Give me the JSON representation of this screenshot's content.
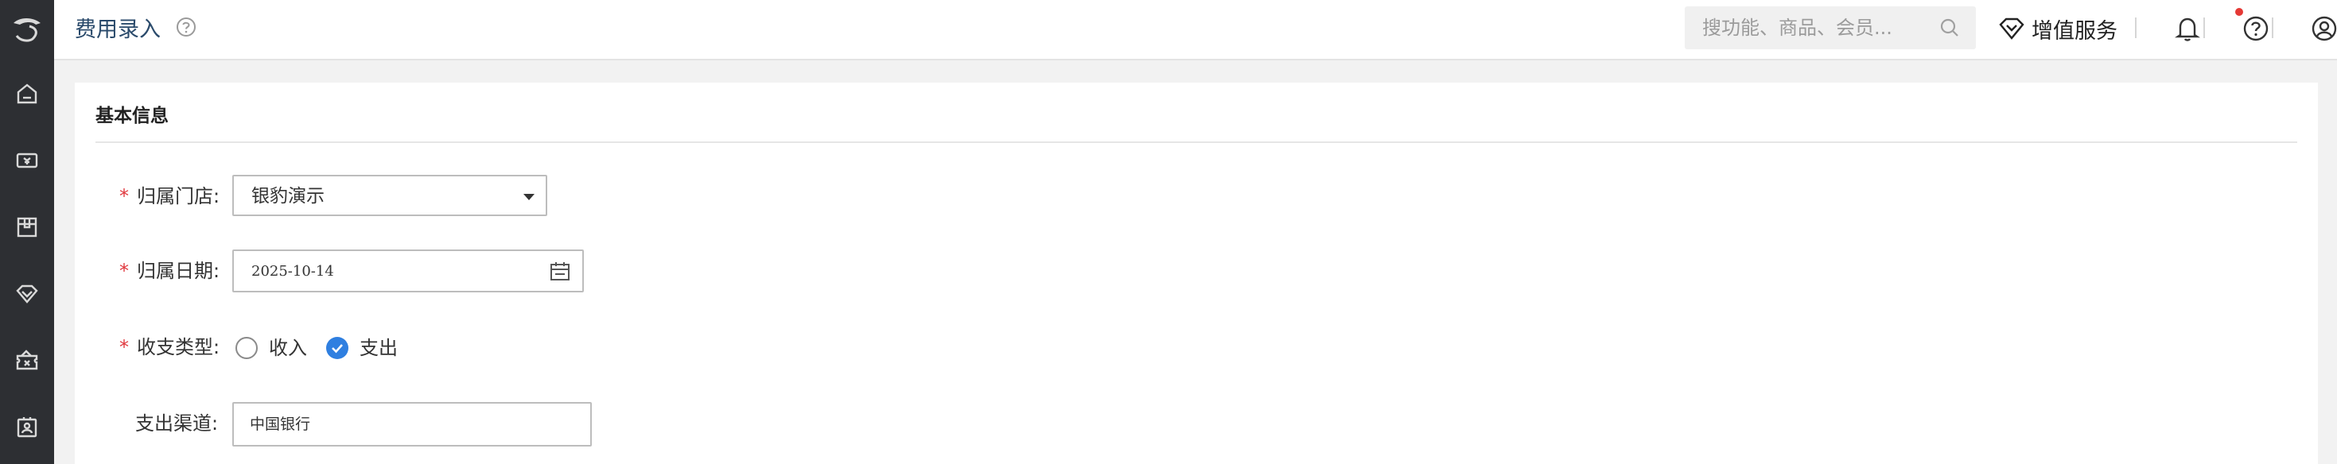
{
  "header": {
    "title": "费用录入",
    "search_placeholder": "搜功能、商品、会员...",
    "value_added_label": "增值服务"
  },
  "sidebar": {
    "items": [
      {
        "icon": "home-icon"
      },
      {
        "icon": "cashier-icon"
      },
      {
        "icon": "goods-icon"
      },
      {
        "icon": "member-diamond-icon"
      },
      {
        "icon": "coupon-icon"
      },
      {
        "icon": "staff-card-icon"
      }
    ]
  },
  "form": {
    "section_title": "基本信息",
    "store": {
      "required_mark": "*",
      "label": "归属门店:",
      "value": "银豹演示"
    },
    "date": {
      "required_mark": "*",
      "label": "归属日期:",
      "value": "2025-10-14"
    },
    "type": {
      "required_mark": "*",
      "label": "收支类型:",
      "options": [
        {
          "label": "收入",
          "checked": false
        },
        {
          "label": "支出",
          "checked": true
        }
      ]
    },
    "channel": {
      "label": "支出渠道:",
      "value": "中国银行"
    }
  },
  "colors": {
    "accent": "#2f7fe0",
    "required": "#e0383e",
    "sidebar_bg": "#2d2f33",
    "notification_dot": "#e53935"
  }
}
